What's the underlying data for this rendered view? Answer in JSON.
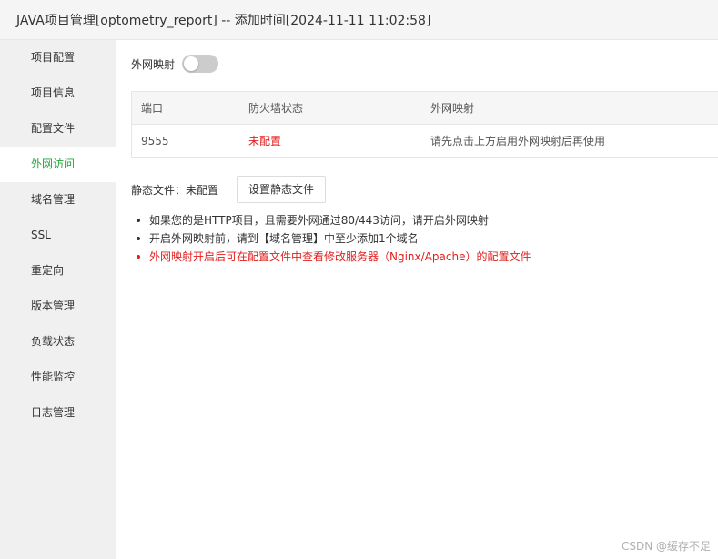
{
  "window": {
    "title": "JAVA项目管理[optometry_report] -- 添加时间[2024-11-11 11:02:58]"
  },
  "sidebar": {
    "items": [
      {
        "label": "项目配置"
      },
      {
        "label": "项目信息"
      },
      {
        "label": "配置文件"
      },
      {
        "label": "外网访问",
        "active": true
      },
      {
        "label": "域名管理"
      },
      {
        "label": "SSL"
      },
      {
        "label": "重定向"
      },
      {
        "label": "版本管理"
      },
      {
        "label": "负载状态"
      },
      {
        "label": "性能监控"
      },
      {
        "label": "日志管理"
      }
    ]
  },
  "main": {
    "toggle": {
      "label": "外网映射",
      "state": "off"
    },
    "table": {
      "headers": [
        "端口",
        "防火墙状态",
        "外网映射"
      ],
      "rows": [
        {
          "port": "9555",
          "firewall": "未配置",
          "mapping": "请先点击上方启用外网映射后再使用"
        }
      ]
    },
    "static_files": {
      "label": "静态文件：未配置",
      "button_label": "设置静态文件"
    },
    "notes": [
      {
        "text": "如果您的是HTTP项目，且需要外网通过80/443访问，请开启外网映射"
      },
      {
        "text": "开启外网映射前，请到【域名管理】中至少添加1个域名"
      },
      {
        "text": "外网映射开启后可在配置文件中查看修改服务器（Nginx/Apache）的配置文件",
        "highlight": true
      }
    ]
  },
  "watermark": "CSDN @缓存不足",
  "colors": {
    "accent": "#20a53a",
    "warning": "#e02020",
    "sidebar_bg": "#f0f0f0"
  }
}
